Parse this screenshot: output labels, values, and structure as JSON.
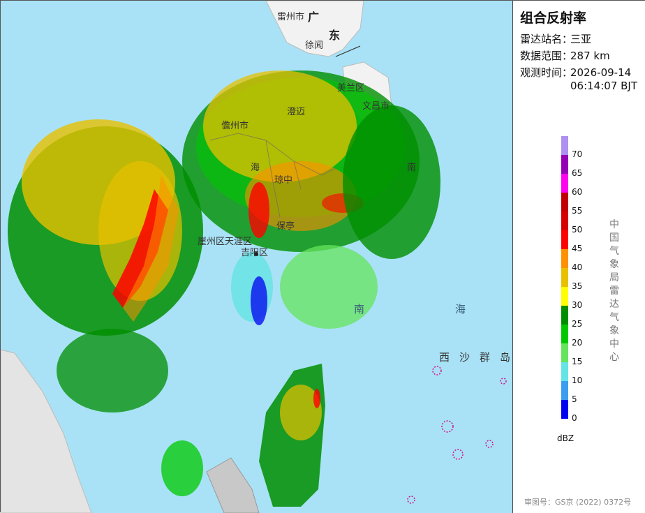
{
  "map": {
    "labels": {
      "leizhou_city": "雷州市",
      "guangdong_1": "广",
      "guangdong_2": "东",
      "xuwen": "徐闻",
      "haikou_meilan": "美兰区",
      "wenchang": "文昌市",
      "chengmai": "澄迈",
      "danzhou": "儋州市",
      "hai": "海",
      "nan": "南",
      "qionghai": "琼中",
      "baoting": "保亭",
      "sanya_tianya": "崖州区天涯区",
      "jiyang": "吉阳区",
      "south_sea_1": "南",
      "south_sea_2": "海",
      "xisha": "西沙群岛"
    }
  },
  "panel": {
    "title": "组合反射率",
    "station_key": "雷达站名：",
    "station_val": "三亚",
    "range_key": "数据范围：",
    "range_val": "287 km",
    "time_key": "观测时间：",
    "time_val_date": "2026-09-14",
    "time_val_time": "06:14:07 BJT",
    "legend_unit": "dBZ",
    "credit": "中国气象局雷达气象中心",
    "approval": "审图号：GS京 (2022) 0372号",
    "legend": [
      {
        "value": "70",
        "color": "#ad90f0"
      },
      {
        "value": "65",
        "color": "#9600b4"
      },
      {
        "value": "60",
        "color": "#ff00f0"
      },
      {
        "value": "55",
        "color": "#c00000"
      },
      {
        "value": "50",
        "color": "#d60000"
      },
      {
        "value": "45",
        "color": "#ff0000"
      },
      {
        "value": "40",
        "color": "#ff9000"
      },
      {
        "value": "35",
        "color": "#e7c000"
      },
      {
        "value": "30",
        "color": "#ffff00"
      },
      {
        "value": "25",
        "color": "#008e00"
      },
      {
        "value": "20",
        "color": "#00c800"
      },
      {
        "value": "15",
        "color": "#66e45c"
      },
      {
        "value": "10",
        "color": "#64e4e4"
      },
      {
        "value": "5",
        "color": "#3c9cf0"
      },
      {
        "value": "0",
        "color": "#0000f0"
      }
    ]
  }
}
